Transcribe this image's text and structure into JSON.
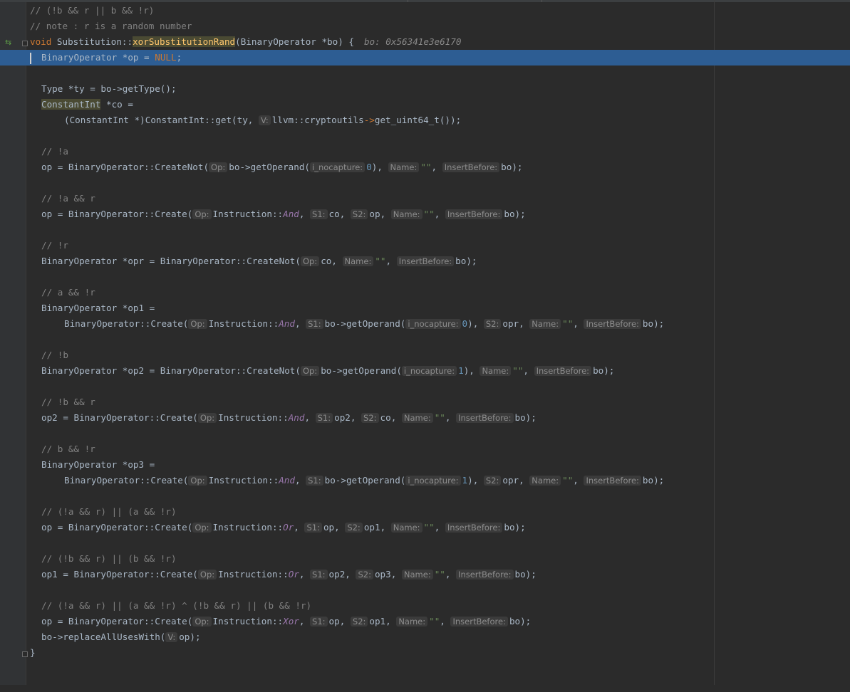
{
  "colors": {
    "background": "#2b2b2b",
    "gutter": "#313335",
    "highlight": "#2d5d93",
    "comment": "#808080",
    "keyword": "#cc7832",
    "function": "#ffc66d",
    "number": "#6897bb",
    "string": "#6a8759",
    "enum": "#9876aa",
    "breakpoint": "#c75450"
  },
  "gutter_icons": [
    "step-arrows-icon",
    "breakpoint-icon",
    "execution-point-icon",
    "fold-icon"
  ],
  "code": {
    "comment1": "// (!b && r || b && !r)",
    "comment2": "// note : r is a random number",
    "sig_void": "void",
    "sig_class": " Substitution::",
    "sig_fn": "xorSubstitutionRand",
    "sig_params": "(BinaryOperator *bo) {",
    "sig_debug": "bo: 0x56341e3e6170",
    "l4_a": "BinaryOperator *op = ",
    "l4_null": "NULL",
    "l4_b": ";",
    "l6": "Type *ty = bo->getType();",
    "l7_type": "ConstantInt",
    "l7_rest": " *co =",
    "l8_a": "(ConstantInt *)ConstantInt::get(ty, ",
    "l8_hint": "V:",
    "l8_b": "llvm::cryptoutils",
    "l8_arrow": "->",
    "l8_c": "get_uint64_t());",
    "c_nota": "// !a",
    "l11_a": "op = BinaryOperator::CreateNot(",
    "hint_op": "Op:",
    "l11_b": "bo->getOperand(",
    "hint_nocap": "i_nocapture:",
    "zero": "0",
    "one": "1",
    "hint_name": "Name:",
    "empty_str": "\"\"",
    "hint_insert": "InsertBefore:",
    "bo_end": "bo);",
    "comma": ", ",
    "close_paren": "), ",
    "c_nota_r": "// !a && r",
    "l14_a": "op = BinaryOperator::Create(",
    "instr": "Instruction::",
    "and": "And",
    "or": "Or",
    "xor": "Xor",
    "hint_s1": "S1:",
    "hint_s2": "S2:",
    "co": "co",
    "op": "op",
    "c_notr": "// !r",
    "l17_a": "BinaryOperator *opr = BinaryOperator::CreateNot(",
    "c_a_notr": "// a && !r",
    "l20": "BinaryOperator *op1 =",
    "l21_a": "BinaryOperator::Create(",
    "bo_getop": "bo->getOperand(",
    "opr": "opr",
    "c_notb": "// !b",
    "l24_a": "BinaryOperator *op2 = BinaryOperator::CreateNot(",
    "c_notb_r": "// !b && r",
    "l27_a": "op2 = BinaryOperator::Create(",
    "op2": "op2",
    "c_b_notr": "// b && !r",
    "l30": "BinaryOperator *op3 =",
    "c_or1": "// (!a && r) || (a && !r)",
    "op1": "op1",
    "c_or2": "// (!b && r) || (b && !r)",
    "l37_a": "op1 = BinaryOperator::Create(",
    "op3": "op3",
    "c_xor": "// (!a && r) || (a && !r) ^ (!b && r) || (b && !r)",
    "l41_a": "bo->replaceAllUsesWith(",
    "hint_v": "V:",
    "l41_b": "op);",
    "close_brace": "}"
  }
}
